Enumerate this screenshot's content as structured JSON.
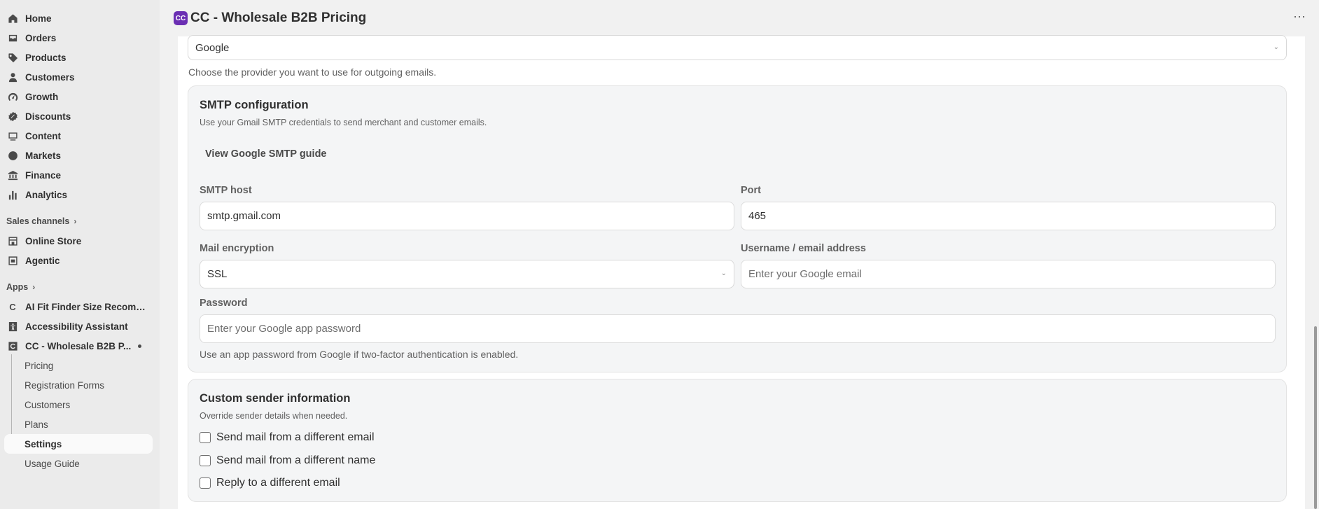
{
  "sidebar": {
    "nav": [
      {
        "label": "Home",
        "icon": "home-icon"
      },
      {
        "label": "Orders",
        "icon": "orders-icon"
      },
      {
        "label": "Products",
        "icon": "tag-icon"
      },
      {
        "label": "Customers",
        "icon": "person-icon"
      },
      {
        "label": "Growth",
        "icon": "gauge-icon"
      },
      {
        "label": "Discounts",
        "icon": "discount-icon"
      },
      {
        "label": "Content",
        "icon": "content-icon"
      },
      {
        "label": "Markets",
        "icon": "globe-icon"
      },
      {
        "label": "Finance",
        "icon": "bank-icon"
      },
      {
        "label": "Analytics",
        "icon": "bar-chart-icon"
      }
    ],
    "sales_channels_label": "Sales channels",
    "channels": [
      {
        "label": "Online Store",
        "icon": "store-icon"
      },
      {
        "label": "Agentic",
        "icon": "agentic-icon"
      }
    ],
    "apps_label": "Apps",
    "apps": [
      {
        "label": "AI Fit Finder Size Recomm...",
        "icon": "letter-c-icon"
      },
      {
        "label": "Accessibility Assistant",
        "icon": "accessibility-icon"
      },
      {
        "label": "CC - Wholesale B2B P...",
        "icon": "cc-app-icon"
      }
    ],
    "sub_items": [
      "Pricing",
      "Registration Forms",
      "Customers",
      "Plans",
      "Settings",
      "Usage Guide"
    ]
  },
  "header": {
    "app_badge": "CC",
    "title": "CC - Wholesale B2B Pricing",
    "more": "⋯"
  },
  "provider": {
    "selected": "Google",
    "help": "Choose the provider you want to use for outgoing emails."
  },
  "smtp": {
    "title": "SMTP configuration",
    "subtitle": "Use your Gmail SMTP credentials to send merchant and customer emails.",
    "guide_link": "View Google SMTP guide",
    "host_label": "SMTP host",
    "host_value": "smtp.gmail.com",
    "port_label": "Port",
    "port_value": "465",
    "encryption_label": "Mail encryption",
    "encryption_value": "SSL",
    "username_label": "Username / email address",
    "username_placeholder": "Enter your Google email",
    "password_label": "Password",
    "password_placeholder": "Enter your Google app password",
    "password_help": "Use an app password from Google if two-factor authentication is enabled."
  },
  "sender": {
    "title": "Custom sender information",
    "subtitle": "Override sender details when needed.",
    "options": [
      "Send mail from a different email",
      "Send mail from a different name",
      "Reply to a different email"
    ]
  }
}
